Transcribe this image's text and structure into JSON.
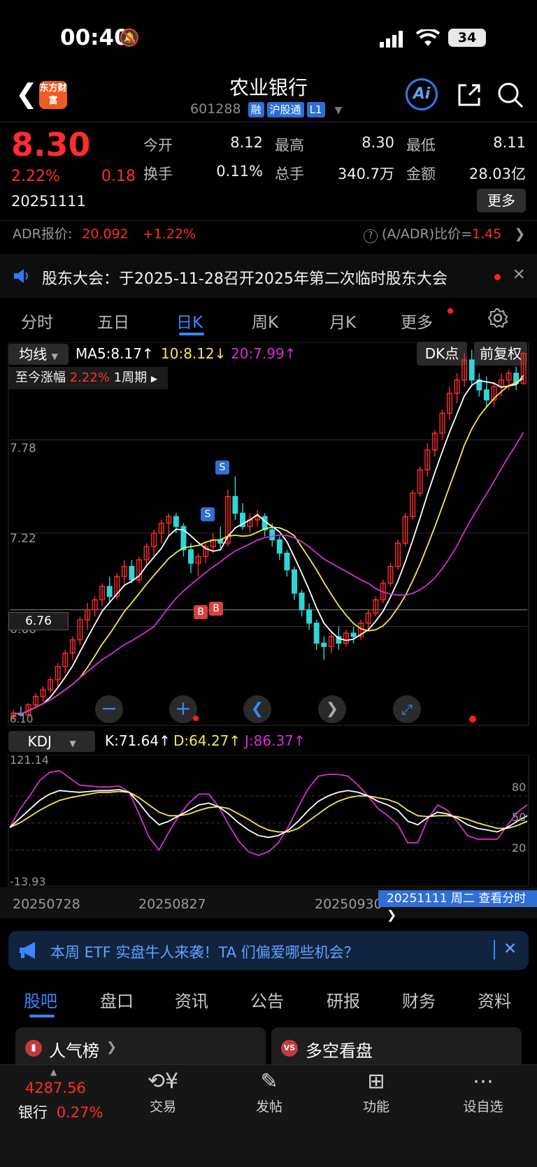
{
  "status_bar": {
    "time": "00:40",
    "battery": "34"
  },
  "header": {
    "title": "农业银行",
    "code": "601288",
    "tags": [
      "融",
      "沪股通",
      "L1"
    ],
    "logo_text": "东方财富"
  },
  "quote": {
    "price": "8.30",
    "change_pct": "2.22%",
    "change": "0.18",
    "date": "20251111",
    "open_label": "今开",
    "open": "8.12",
    "high_label": "最高",
    "high": "8.30",
    "low_label": "最低",
    "low": "8.11",
    "turnover_label": "换手",
    "turnover": "0.11%",
    "volume_label": "总手",
    "volume": "340.7万",
    "amount_label": "金额",
    "amount": "28.03亿",
    "more_label": "更多"
  },
  "adr": {
    "label": "ADR报价:",
    "price": "20.092",
    "change": "+1.22%",
    "ratio_label": "(A/ADR)比价=",
    "ratio": "1.45"
  },
  "notice": {
    "text": "股东大会：于2025-11-28召开2025年第二次临时股东大会"
  },
  "chart_tabs": [
    "分时",
    "五日",
    "日K",
    "周K",
    "月K",
    "更多"
  ],
  "ma_bar": {
    "type_label": "均线",
    "ma5": "MA5:8.17↑",
    "ma10": "10:8.12↓",
    "ma20": "20:7.99↑",
    "dk_label": "DK点",
    "adjust_label": "前复权"
  },
  "range_info": {
    "label": "至今涨幅",
    "value": "2.22%",
    "period": "1周期"
  },
  "price_axis": {
    "top_label": "7.78",
    "mid_label": "7.22",
    "low_label": "6.66",
    "bottom_label": "6.10",
    "crosshair_label": "6.76"
  },
  "markers": {
    "sell": "S",
    "buy": "B"
  },
  "kdj_bar": {
    "type_label": "KDJ",
    "k": "K:71.64↑",
    "d": "D:64.27↑",
    "j": "J:86.37↑"
  },
  "kdj_axis": {
    "top": "121.14",
    "bottom": "-13.93",
    "l80": "80",
    "l50": "50",
    "l20": "20"
  },
  "date_axis": [
    "20250728",
    "20250827",
    "20250930"
  ],
  "date_tip": "20251111 周二 查看分时",
  "banner": {
    "text": "本周 ETF 实盘牛人来袭！TA 们偏爱哪些机会？"
  },
  "bottom_tabs": [
    "股吧",
    "盘口",
    "资讯",
    "公告",
    "研报",
    "财务",
    "资料"
  ],
  "cards": [
    "人气榜",
    "多空看盘"
  ],
  "bottom_nav": {
    "index_value": "4287.56",
    "index_name": "银行",
    "index_change": "0.27%",
    "items": [
      "交易",
      "发帖",
      "功能",
      "设自选"
    ]
  },
  "colors": {
    "up": "#ff2d2d",
    "down": "#30d5d5",
    "ma5": "#ffffff",
    "ma10": "#f5e94a",
    "ma20": "#d62fd6",
    "accent": "#2f7bf0"
  },
  "chart_data": {
    "type": "candlestick",
    "ohlc": [
      [
        6.12,
        6.16,
        6.1,
        6.14
      ],
      [
        6.14,
        6.18,
        6.12,
        6.13
      ],
      [
        6.13,
        6.2,
        6.12,
        6.19
      ],
      [
        6.19,
        6.26,
        6.17,
        6.24
      ],
      [
        6.24,
        6.3,
        6.21,
        6.28
      ],
      [
        6.28,
        6.36,
        6.26,
        6.34
      ],
      [
        6.34,
        6.44,
        6.3,
        6.42
      ],
      [
        6.42,
        6.52,
        6.38,
        6.5
      ],
      [
        6.5,
        6.6,
        6.46,
        6.58
      ],
      [
        6.58,
        6.72,
        6.55,
        6.7
      ],
      [
        6.7,
        6.8,
        6.64,
        6.76
      ],
      [
        6.76,
        6.84,
        6.72,
        6.82
      ],
      [
        6.82,
        6.92,
        6.78,
        6.9
      ],
      [
        6.9,
        6.96,
        6.8,
        6.84
      ],
      [
        6.84,
        6.98,
        6.82,
        6.96
      ],
      [
        6.96,
        7.06,
        6.9,
        7.02
      ],
      [
        7.02,
        7.06,
        6.92,
        6.94
      ],
      [
        6.94,
        7.08,
        6.92,
        7.06
      ],
      [
        7.06,
        7.16,
        7.02,
        7.14
      ],
      [
        7.14,
        7.24,
        7.08,
        7.22
      ],
      [
        7.22,
        7.3,
        7.16,
        7.28
      ],
      [
        7.28,
        7.34,
        7.2,
        7.32
      ],
      [
        7.32,
        7.34,
        7.22,
        7.26
      ],
      [
        7.26,
        7.28,
        7.08,
        7.12
      ],
      [
        7.12,
        7.16,
        6.98,
        7.04
      ],
      [
        7.04,
        7.1,
        6.96,
        7.08
      ],
      [
        7.08,
        7.16,
        7.04,
        7.14
      ],
      [
        7.14,
        7.22,
        7.1,
        7.18
      ],
      [
        7.18,
        7.26,
        7.12,
        7.16
      ],
      [
        7.16,
        7.48,
        7.14,
        7.44
      ],
      [
        7.44,
        7.56,
        7.3,
        7.34
      ],
      [
        7.34,
        7.4,
        7.24,
        7.26
      ],
      [
        7.26,
        7.34,
        7.22,
        7.3
      ],
      [
        7.3,
        7.36,
        7.26,
        7.32
      ],
      [
        7.32,
        7.34,
        7.2,
        7.24
      ],
      [
        7.24,
        7.28,
        7.14,
        7.18
      ],
      [
        7.18,
        7.2,
        7.06,
        7.1
      ],
      [
        7.1,
        7.12,
        6.96,
        7.0
      ],
      [
        7.0,
        7.02,
        6.82,
        6.86
      ],
      [
        6.86,
        6.88,
        6.72,
        6.76
      ],
      [
        6.76,
        6.8,
        6.64,
        6.68
      ],
      [
        6.68,
        6.7,
        6.52,
        6.56
      ],
      [
        6.56,
        6.6,
        6.46,
        6.54
      ],
      [
        6.54,
        6.62,
        6.5,
        6.6
      ],
      [
        6.6,
        6.66,
        6.52,
        6.56
      ],
      [
        6.56,
        6.64,
        6.54,
        6.62
      ],
      [
        6.62,
        6.66,
        6.56,
        6.6
      ],
      [
        6.6,
        6.7,
        6.58,
        6.68
      ],
      [
        6.68,
        6.76,
        6.64,
        6.74
      ],
      [
        6.74,
        6.84,
        6.72,
        6.82
      ],
      [
        6.82,
        6.94,
        6.8,
        6.92
      ],
      [
        6.92,
        7.04,
        6.9,
        7.02
      ],
      [
        7.02,
        7.18,
        7.0,
        7.16
      ],
      [
        7.16,
        7.34,
        7.14,
        7.32
      ],
      [
        7.32,
        7.48,
        7.3,
        7.46
      ],
      [
        7.46,
        7.62,
        7.44,
        7.6
      ],
      [
        7.6,
        7.76,
        7.56,
        7.72
      ],
      [
        7.72,
        7.84,
        7.68,
        7.82
      ],
      [
        7.82,
        7.96,
        7.78,
        7.94
      ],
      [
        7.94,
        8.1,
        7.9,
        8.06
      ],
      [
        8.06,
        8.18,
        8.0,
        8.14
      ],
      [
        8.14,
        8.3,
        8.1,
        8.26
      ],
      [
        8.26,
        8.32,
        8.1,
        8.14
      ],
      [
        8.14,
        8.18,
        8.04,
        8.08
      ],
      [
        8.08,
        8.16,
        7.98,
        8.02
      ],
      [
        8.02,
        8.12,
        7.98,
        8.1
      ],
      [
        8.1,
        8.18,
        8.04,
        8.14
      ],
      [
        8.14,
        8.2,
        8.08,
        8.18
      ],
      [
        8.18,
        8.22,
        8.08,
        8.12
      ],
      [
        8.12,
        8.3,
        8.11,
        8.3
      ]
    ],
    "ylim": [
      6.1,
      8.34
    ],
    "kdj": {
      "k": [
        45,
        55,
        65,
        75,
        82,
        86,
        85,
        84,
        85,
        86,
        86,
        87,
        84,
        72,
        58,
        48,
        52,
        58,
        64,
        70,
        72,
        68,
        60,
        50,
        42,
        36,
        34,
        36,
        42,
        52,
        64,
        74,
        80,
        84,
        86,
        84,
        80,
        74,
        70,
        64,
        52,
        48,
        56,
        62,
        60,
        55,
        48,
        44,
        42,
        40,
        45,
        52,
        58
      ],
      "d": [
        45,
        50,
        57,
        64,
        70,
        75,
        78,
        80,
        82,
        84,
        84,
        85,
        84,
        78,
        70,
        62,
        58,
        58,
        60,
        64,
        67,
        68,
        66,
        60,
        54,
        47,
        42,
        40,
        40,
        44,
        52,
        60,
        68,
        74,
        78,
        80,
        80,
        78,
        76,
        72,
        64,
        58,
        57,
        58,
        58,
        57,
        54,
        50,
        47,
        44,
        44,
        47,
        52
      ],
      "j": [
        45,
        65,
        80,
        97,
        106,
        108,
        100,
        92,
        91,
        90,
        90,
        91,
        84,
        60,
        34,
        20,
        40,
        58,
        72,
        82,
        82,
        68,
        48,
        30,
        18,
        14,
        18,
        28,
        46,
        68,
        88,
        102,
        104,
        104,
        102,
        92,
        80,
        66,
        58,
        48,
        28,
        28,
        54,
        70,
        64,
        51,
        36,
        32,
        32,
        32,
        47,
        62,
        70
      ]
    }
  }
}
